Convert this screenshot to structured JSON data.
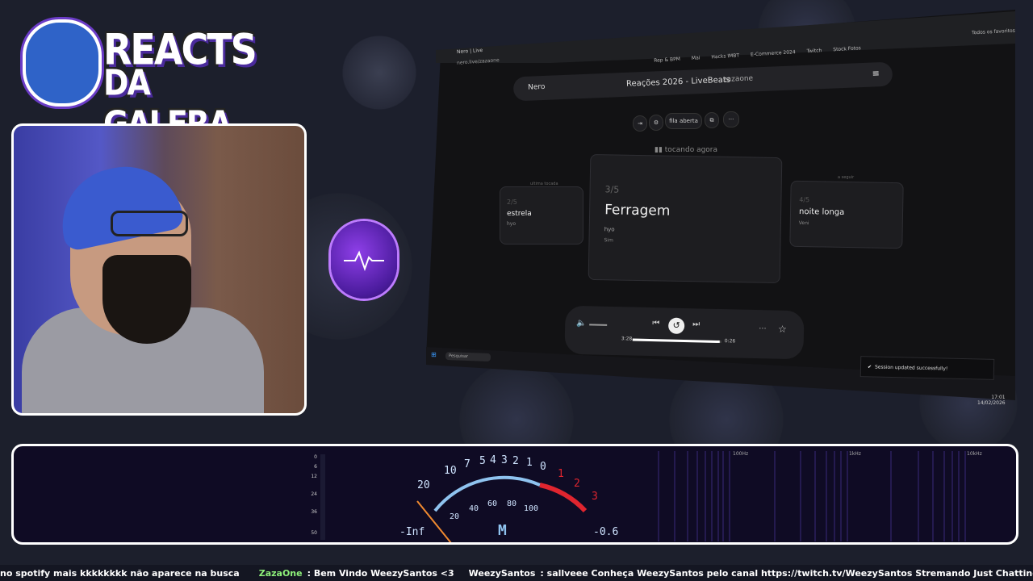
{
  "overlay": {
    "logo_line1": "REACTS",
    "logo_line2": "DA GALERA"
  },
  "browser": {
    "tab_title": "Nero | Live",
    "url": "nero.live/zazaone",
    "bookmarks": [
      "Rep & BPM",
      "Mai",
      "Hacks IMBT",
      "E-Commerce 2024",
      "Twitch",
      "Stock Fotos",
      "Todos os favoritos"
    ],
    "app": {
      "name": "Nero",
      "title": "Reações 2026 - LiveBeats",
      "user": "zazaone",
      "toolbar_button": "fila aberta",
      "now_playing_label": "tocando agora",
      "prev_caption": "ultima tocada",
      "next_caption": "a seguir",
      "prev": {
        "index": "2/5",
        "song": "estrela",
        "artist": "hyo"
      },
      "current": {
        "index": "3/5",
        "song": "Ferragem",
        "artist": "hyo",
        "extra": "Sim"
      },
      "next": {
        "index": "4/5",
        "song": "noite longa",
        "artist": "Veni"
      },
      "player": {
        "elapsed": "3:28",
        "total": "0:26",
        "progress": 0.98
      }
    },
    "toast": "Session updated successfully!",
    "taskbar": {
      "search": "Pesquisar",
      "time": "17:01",
      "date": "14/02/2026"
    }
  },
  "audio": {
    "left_meter_labels": [
      "0",
      "6",
      "12",
      "24",
      "36",
      "50"
    ],
    "vu_scale_black": [
      "20",
      "10",
      "7",
      "5",
      "4",
      "3",
      "2",
      "1",
      "0"
    ],
    "vu_scale_red": [
      "1",
      "2",
      "3"
    ],
    "vu_scale_inner": [
      "20",
      "40",
      "60",
      "80",
      "100"
    ],
    "vu_left_value": "-Inf",
    "vu_right_value": "-0.6",
    "vu_mode": "M",
    "spectrum_labels": [
      "100Hz",
      "1kHz",
      "10kHz"
    ]
  },
  "ticker": {
    "part1": "no spotify mais kkkkkkkk  não aparece na busca",
    "user1": "ZazaOne",
    "msg1": ":  Bem Vindo WeezySantos <3",
    "user2": "WeezySantos",
    "msg2": ":  sallveee  Conheça WeezySantos pelo canal https://twitch.tv/WeezySantos Stremando Just Chatting"
  },
  "colors": {
    "accent": "#8e3fe8",
    "ticker_user": "#8ef07a",
    "vu_red": "#e0252f",
    "vu_blue": "#8fc3ef"
  }
}
